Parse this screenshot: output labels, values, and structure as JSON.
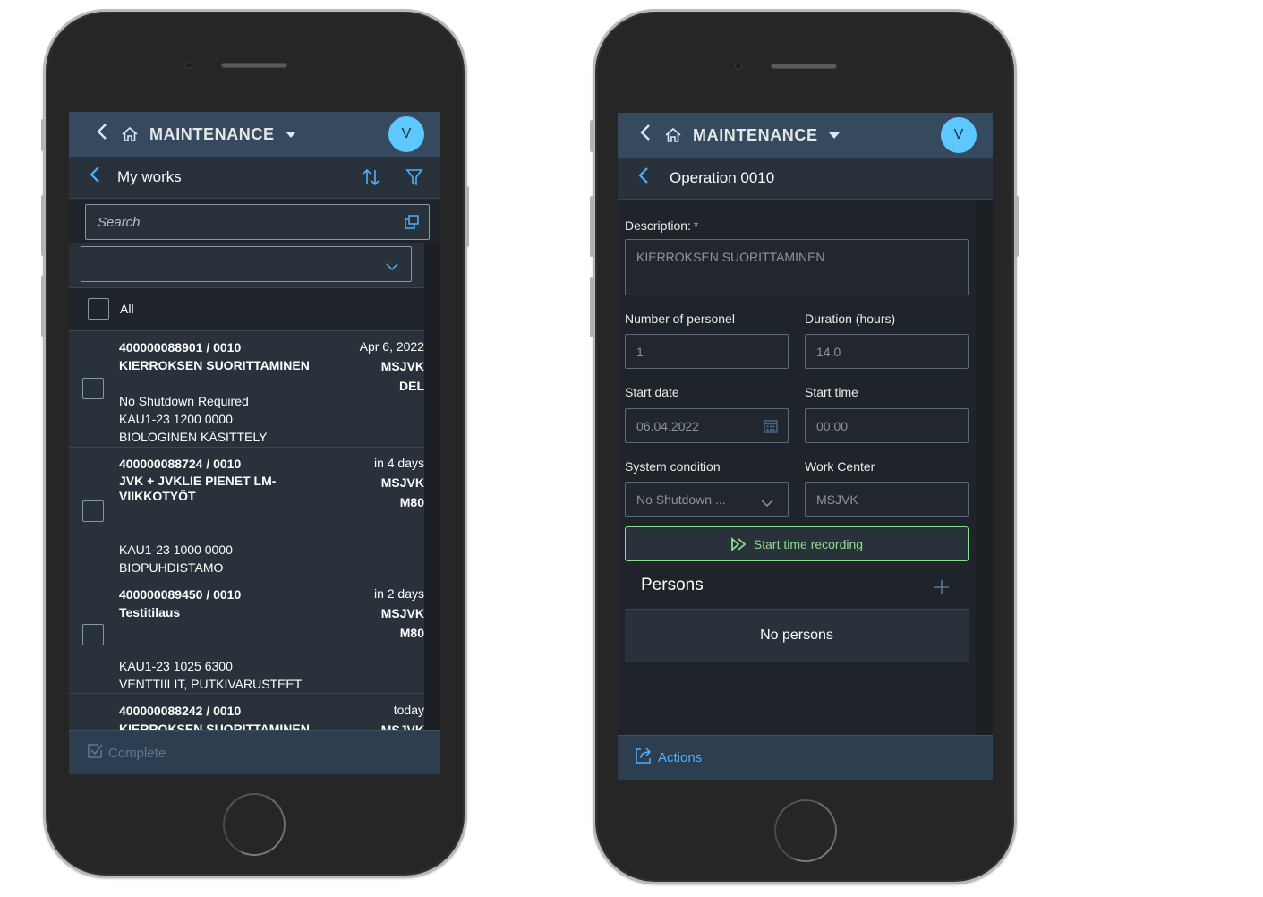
{
  "left_phone": {
    "shell": {
      "back_icon": "chevron-left-icon",
      "home_icon": "home-icon",
      "title": "MAINTENANCE",
      "menu_icon": "caret-down-icon",
      "avatar_initial": "V"
    },
    "subheader": {
      "back_icon": "chevron-left-icon",
      "title": "My works",
      "sort_icon": "sort-icon",
      "filter_icon": "filter-icon"
    },
    "search": {
      "placeholder": "Search",
      "icon": "copy-icon"
    },
    "dropdown": {
      "value": "",
      "icon": "chevron-down-icon"
    },
    "select_all_label": "All",
    "items": [
      {
        "id": "400000088901 / 0010",
        "title": "KIERROKSEN SUORITTAMINEN",
        "date": "Apr 6, 2022",
        "work_center": "MSJVK",
        "code": "DEL",
        "system_condition": "No Shutdown Required",
        "location": "KAU1-23 1200 0000",
        "location_desc": "BIOLOGINEN KÄSITTELY"
      },
      {
        "id": "400000088724 / 0010",
        "title": "JVK + JVKLIE PIENET LM-VIIKKOTYÖT",
        "title_line1": "JVK + JVKLIE PIENET LM-",
        "title_line2": "VIIKKOTYÖT",
        "date": "in 4 days",
        "work_center": "MSJVK",
        "code": "M80",
        "location": "KAU1-23 1000 0000",
        "location_desc": "BIOPUHDISTAMO"
      },
      {
        "id": "400000089450 / 0010",
        "title": "Testitilaus",
        "date": "in 2 days",
        "work_center": "MSJVK",
        "code": "M80",
        "location": "KAU1-23 1025 6300",
        "location_desc": "VENTTIILIT, PUTKIVARUSTEET"
      },
      {
        "id": "400000088242 / 0010",
        "title": "KIERROKSEN SUORITTAMINEN",
        "date": "today",
        "work_center": "MSJVK"
      }
    ],
    "footer": {
      "icon": "complete-icon",
      "label": "Complete"
    }
  },
  "right_phone": {
    "shell": {
      "back_icon": "chevron-left-icon",
      "home_icon": "home-icon",
      "title": "MAINTENANCE",
      "menu_icon": "caret-down-icon",
      "avatar_initial": "V"
    },
    "subheader": {
      "back_icon": "chevron-left-icon",
      "title": "Operation 0010"
    },
    "form": {
      "description_label": "Description:",
      "required_mark": "*",
      "description_value": "KIERROKSEN SUORITTAMINEN",
      "personnel_label": "Number of personel",
      "personnel_value": "1",
      "duration_label": "Duration (hours)",
      "duration_value": "14.0",
      "start_date_label": "Start date",
      "start_date_value": "06.04.2022",
      "start_time_label": "Start time",
      "start_time_value": "00:00",
      "system_condition_label": "System condition",
      "system_condition_value": "No Shutdown ...",
      "work_center_label": "Work Center",
      "work_center_value": "MSJVK"
    },
    "start_recording_label": "Start time recording",
    "persons": {
      "title": "Persons",
      "empty_text": "No persons"
    },
    "footer": {
      "icon": "share-icon",
      "label": "Actions"
    }
  },
  "colors": {
    "shell_bg": "#354a5f",
    "accent": "#4db1ff",
    "avatar": "#5dc8ff",
    "positive": "#8ddc8f",
    "required": "#ff8888"
  }
}
